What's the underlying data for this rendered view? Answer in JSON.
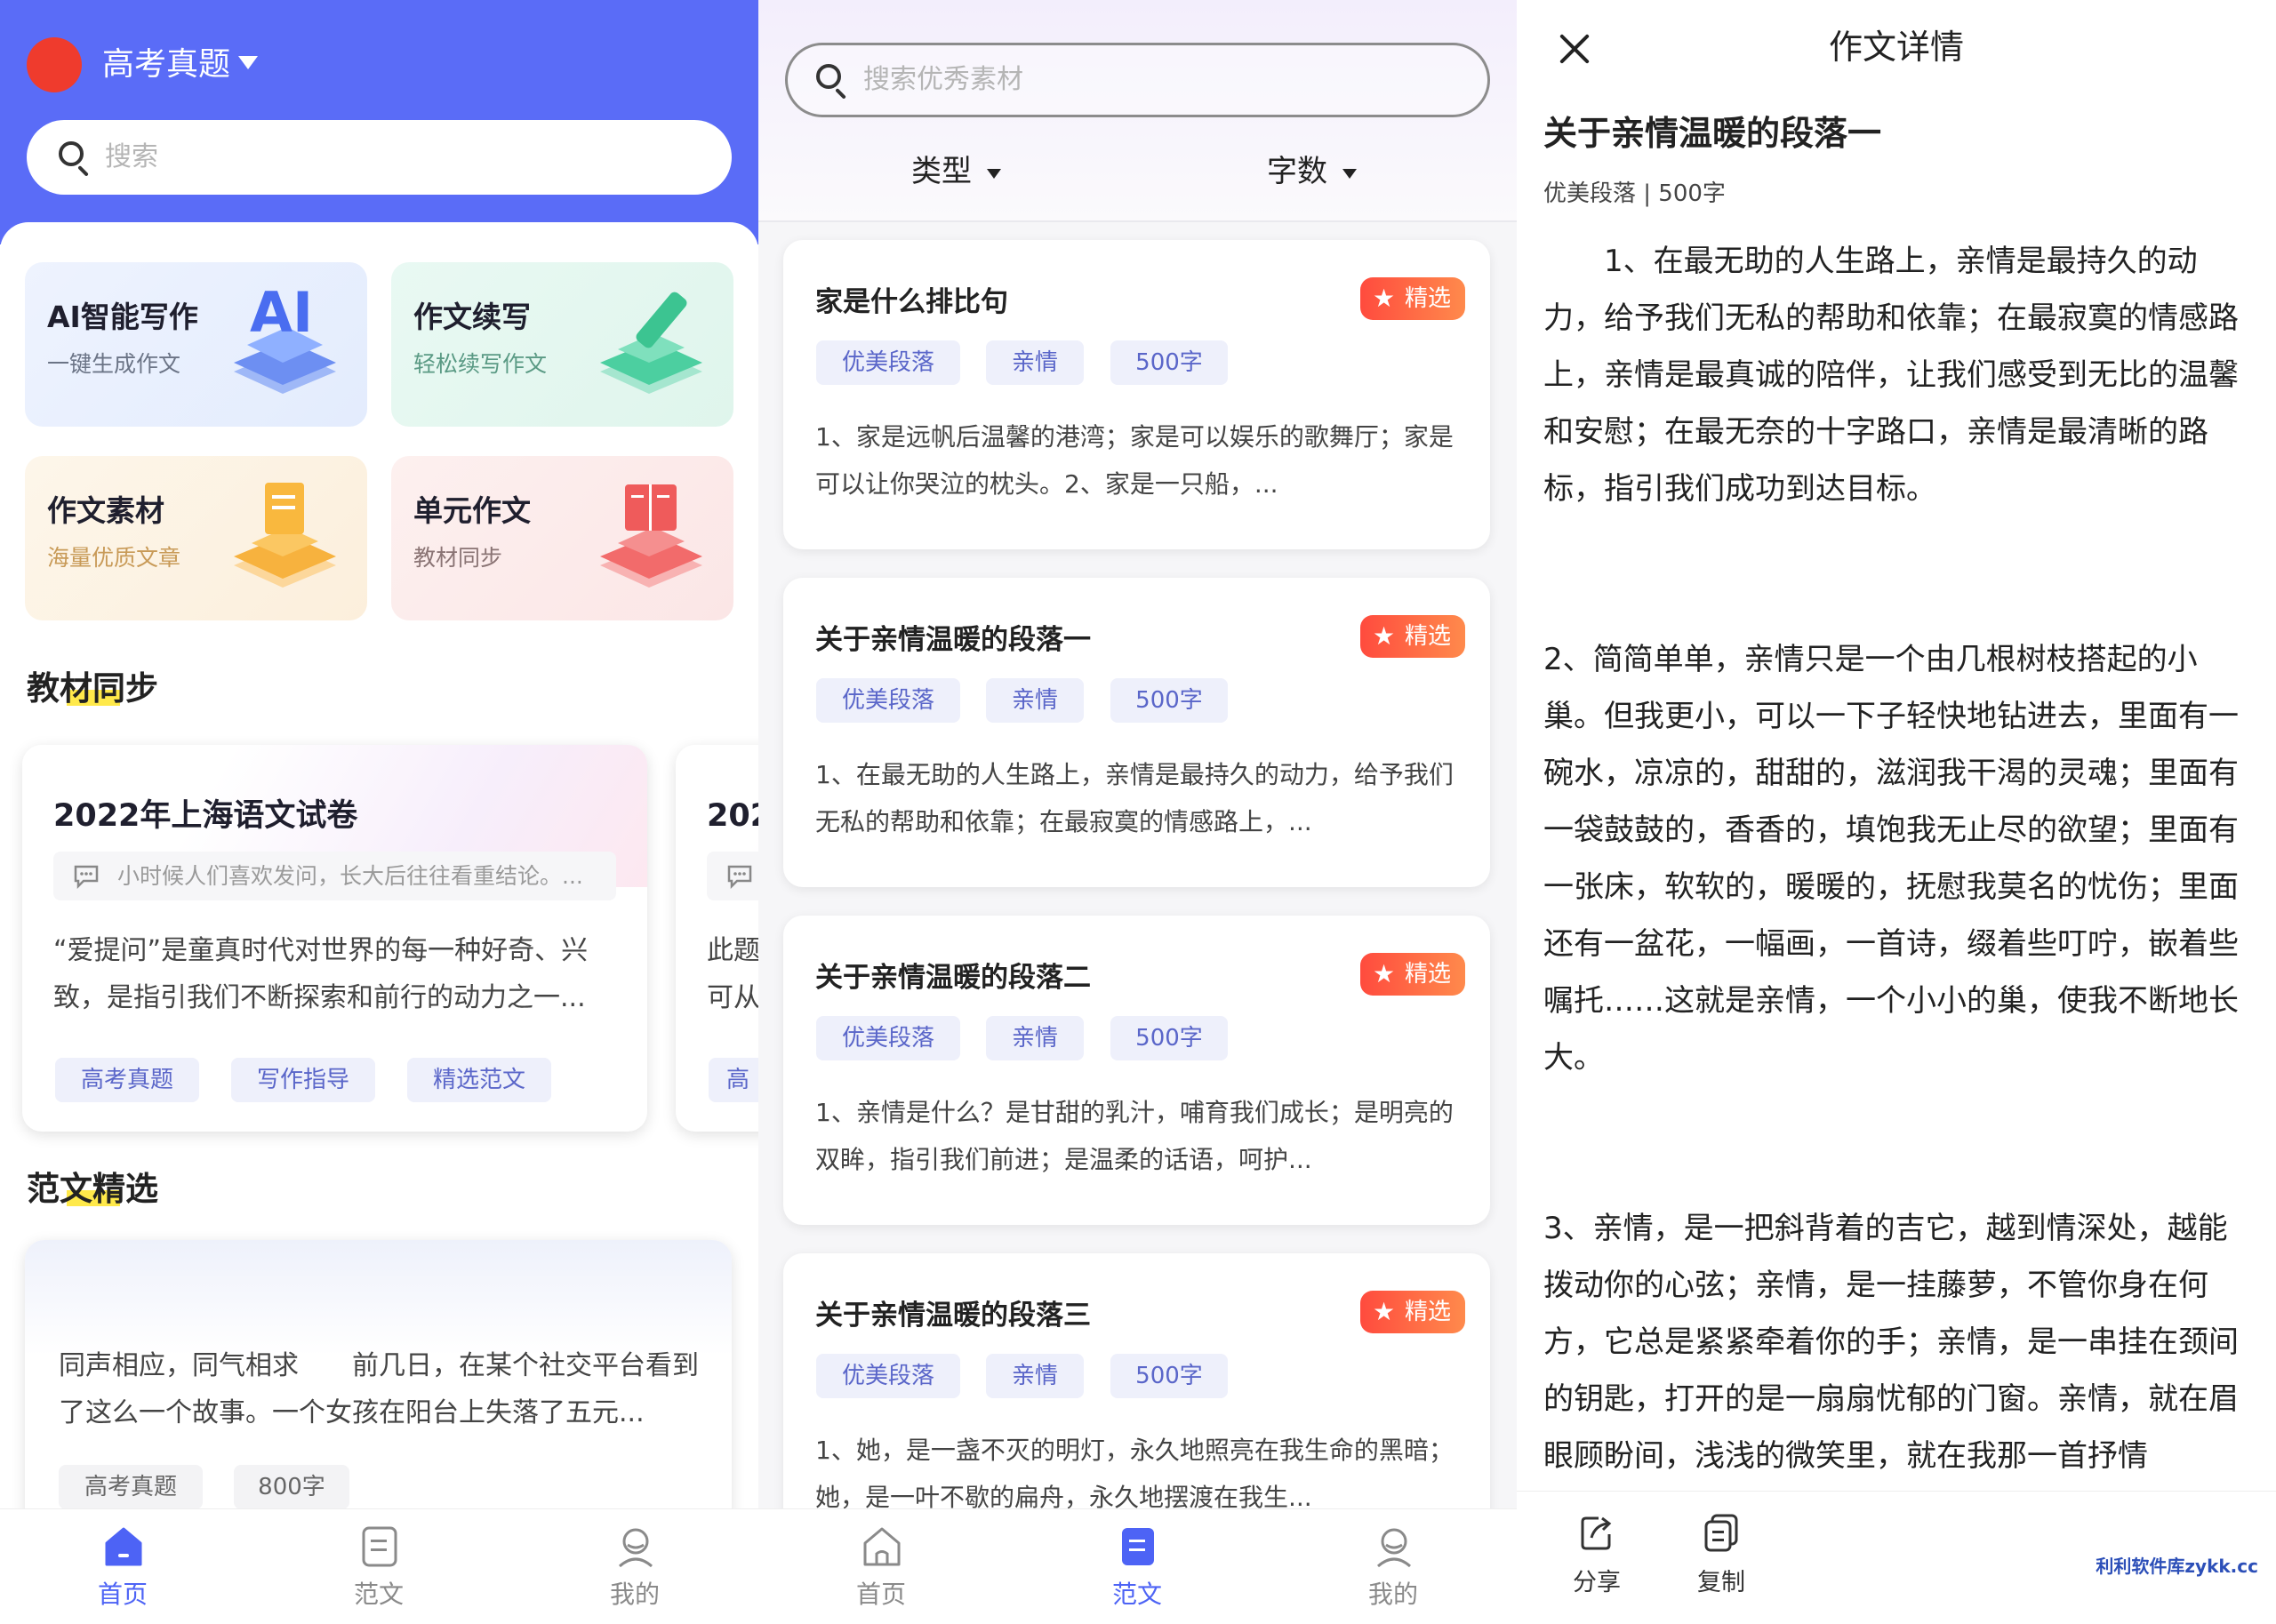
{
  "panel1": {
    "header": {
      "title": "高考真题"
    },
    "search": {
      "placeholder": "搜索"
    },
    "features": [
      {
        "title": "AI智能写作",
        "subtitle": "一键生成作文",
        "icon": "ai-icon",
        "color": "#eaf1fd",
        "subcolor": "#6b7486"
      },
      {
        "title": "作文续写",
        "subtitle": "轻松续写作文",
        "icon": "pen-icon",
        "color": "#e4f7f1",
        "subcolor": "#5a9a84"
      },
      {
        "title": "作文素材",
        "subtitle": "海量优质文章",
        "icon": "document-icon",
        "color": "#fdf3e4",
        "subcolor": "#c89a57"
      },
      {
        "title": "单元作文",
        "subtitle": "教材同步",
        "icon": "book-icon",
        "color": "#fdeceb",
        "subcolor": "#8a7474"
      }
    ],
    "section_textbook": "教材同步",
    "textbook_cards": [
      {
        "title": "2022年上海语文试卷",
        "quote": "小时候人们喜欢发问，长大后往往看重结论。...",
        "excerpt": "“爱提问”是童真时代对世界的每一种好奇、兴致，是指引我们不断探索和前行的动力之一...",
        "tags": [
          "高考真题",
          "写作指导",
          "精选范文"
        ]
      },
      {
        "title": "202",
        "excerpt_line1": "此题",
        "excerpt_line2": "可从",
        "tag": "高"
      }
    ],
    "section_essays": "范文精选",
    "essay_card": {
      "text": "同声相应，同气相求　　前几日，在某个社交平台看到了这么一个故事。一个女孩在阳台上失落了五元...",
      "tags": [
        "高考真题",
        "800字"
      ]
    },
    "tabbar": [
      {
        "label": "首页",
        "active": true
      },
      {
        "label": "范文",
        "active": false
      },
      {
        "label": "我的",
        "active": false
      }
    ]
  },
  "panel2": {
    "search": {
      "placeholder": "搜索优秀素材"
    },
    "filters": [
      "类型",
      "字数"
    ],
    "items": [
      {
        "title": "家是什么排比句",
        "badge": "精选",
        "tags": [
          "优美段落",
          "亲情",
          "500字"
        ],
        "excerpt": "1、家是远帆后温馨的港湾；家是可以娱乐的歌舞厅；家是可以让你哭泣的枕头。2、家是一只船，..."
      },
      {
        "title": "关于亲情温暖的段落一",
        "badge": "精选",
        "tags": [
          "优美段落",
          "亲情",
          "500字"
        ],
        "excerpt": "1、在最无助的人生路上，亲情是最持久的动力，给予我们无私的帮助和依靠；在最寂寞的情感路上，..."
      },
      {
        "title": "关于亲情温暖的段落二",
        "badge": "精选",
        "tags": [
          "优美段落",
          "亲情",
          "500字"
        ],
        "excerpt": "1、亲情是什么？是甘甜的乳汁，哺育我们成长；是明亮的双眸，指引我们前进；是温柔的话语，呵护..."
      },
      {
        "title": "关于亲情温暖的段落三",
        "badge": "精选",
        "tags": [
          "优美段落",
          "亲情",
          "500字"
        ],
        "excerpt": "1、她，是一盏不灭的明灯，永久地照亮在我生命的黑暗；她，是一叶不歇的扁舟，永久地摆渡在我生..."
      }
    ],
    "tabbar": [
      {
        "label": "首页",
        "active": false
      },
      {
        "label": "范文",
        "active": true
      },
      {
        "label": "我的",
        "active": false
      }
    ]
  },
  "panel3": {
    "header": "作文详情",
    "title": "关于亲情温暖的段落一",
    "meta": "优美段落 | 500字",
    "paragraphs": [
      "　　1、在最无助的人生路上，亲情是最持久的动力，给予我们无私的帮助和依靠；在最寂寞的情感路上，亲情是最真诚的陪伴，让我们感受到无比的温馨和安慰；在最无奈的十字路口，亲情是最清晰的路标，指引我们成功到达目标。",
      "2、简简单单，亲情只是一个由几根树枝搭起的小巢。但我更小，可以一下子轻快地钻进去，里面有一碗水，凉凉的，甜甜的，滋润我干渴的灵魂；里面有一袋鼓鼓的，香香的，填饱我无止尽的欲望；里面有一张床，软软的，暖暖的，抚慰我莫名的忧伤；里面还有一盆花，一幅画，一首诗，缀着些叮咛，嵌着些嘱托……这就是亲情，一个小小的巢，使我不断地长大。",
      "3、亲情，是一把斜背着的吉它，越到情深处，越能拨动你的心弦；亲情，是一挂藤萝，不管你身在何方，它总是紧紧牵着你的手；亲情，是一串挂在颈间的钥匙，打开的是一扇扇忧郁的门窗。亲情，就在眉眼顾盼间，浅浅的微笑里，就在我那一首抒情"
    ],
    "actions": [
      {
        "label": "分享",
        "icon": "share-icon"
      },
      {
        "label": "复制",
        "icon": "copy-icon"
      }
    ],
    "watermark": "利利软件库zykk.cc"
  }
}
